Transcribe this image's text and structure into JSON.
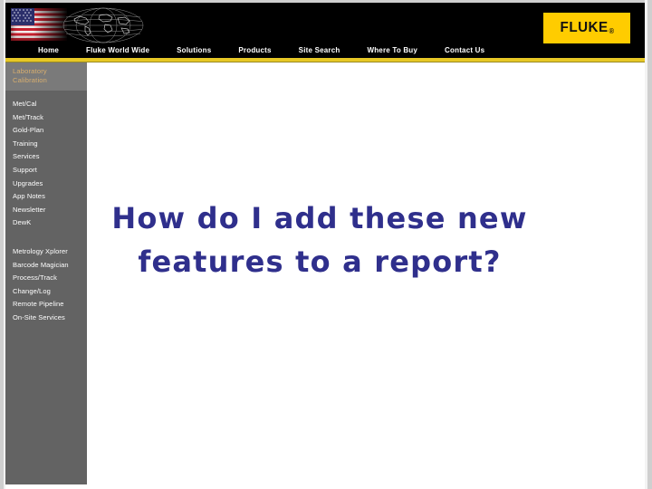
{
  "window": {
    "background_color": "#ffffff",
    "frame_color": "#cfcfcf"
  },
  "header": {
    "background_color": "#000000",
    "banner_icon": "usa-flag-globe-banner",
    "logo": {
      "text": "FLUKE",
      "registered_mark": "®",
      "background_color": "#ffcc00",
      "text_color": "#111111"
    },
    "accent_bar_color": "#e7c826",
    "nav": [
      {
        "label": "Home"
      },
      {
        "label": "Fluke World Wide"
      },
      {
        "label": "Solutions"
      },
      {
        "label": "Products"
      },
      {
        "label": "Site Search"
      },
      {
        "label": "Where To Buy"
      },
      {
        "label": "Contact Us"
      }
    ]
  },
  "sidebar": {
    "background_color": "#636363",
    "heading_background_color": "#7a7a7a",
    "heading_text_color": "#d8ae6e",
    "heading_line1": "Laboratory",
    "heading_line2": "Calibration",
    "group1": [
      {
        "label": "Met/Cal"
      },
      {
        "label": "Met/Track"
      },
      {
        "label": "Gold-Plan"
      },
      {
        "label": "Training"
      },
      {
        "label": "Services"
      },
      {
        "label": "Support"
      },
      {
        "label": "Upgrades"
      },
      {
        "label": "App Notes"
      },
      {
        "label": "Newsletter"
      },
      {
        "label": "DewK"
      }
    ],
    "group2": [
      {
        "label": "Metrology Xplorer"
      },
      {
        "label": "Barcode Magician"
      },
      {
        "label": "Process/Track"
      },
      {
        "label": "Change/Log"
      },
      {
        "label": "Remote Pipeline"
      },
      {
        "label": "On-Site Services"
      }
    ]
  },
  "main": {
    "heading_line1": "How do I add these new",
    "heading_line2": "features to a report?",
    "heading_color": "#2f2f8c"
  }
}
